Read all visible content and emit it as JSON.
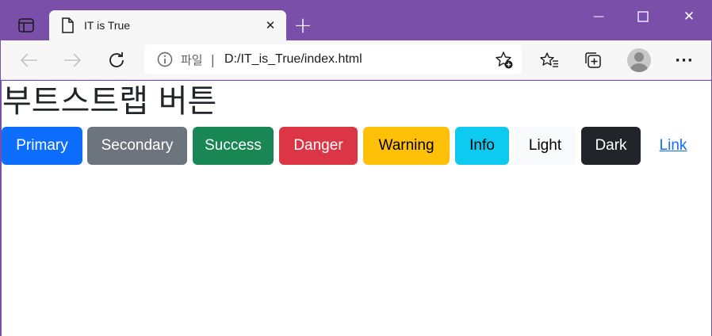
{
  "browser": {
    "tab": {
      "title": "IT is True",
      "close_glyph": "✕"
    },
    "new_tab_glyph": "+",
    "window_controls": {
      "minimize_glyph": "—",
      "close_glyph": "✕"
    },
    "address_bar": {
      "site_label": "파일",
      "separator": "|",
      "url": "D:/IT_is_True/index.html"
    },
    "menu_glyph": "···",
    "icons": [
      "tab-actions-icon",
      "page-icon",
      "back-arrow-icon",
      "forward-arrow-icon",
      "refresh-icon",
      "info-icon",
      "add-favorite-icon",
      "favorites-icon",
      "collections-icon",
      "profile-avatar",
      "more-icon"
    ],
    "colors": {
      "frame": "#7a4fa9",
      "toolbar": "#f7f7f7"
    }
  },
  "page": {
    "title": "부트스트랩 버튼",
    "buttons": [
      {
        "label": "Primary",
        "color": "#0d6efd"
      },
      {
        "label": "Secondary",
        "color": "#6c757d"
      },
      {
        "label": "Success",
        "color": "#198754"
      },
      {
        "label": "Danger",
        "color": "#dc3545"
      },
      {
        "label": "Warning",
        "color": "#ffc107"
      },
      {
        "label": "Info",
        "color": "#0dcaf0"
      },
      {
        "label": "Light",
        "color": "#f8f9fa"
      },
      {
        "label": "Dark",
        "color": "#212529"
      },
      {
        "label": "Link",
        "color": "#0d6efd"
      }
    ]
  }
}
